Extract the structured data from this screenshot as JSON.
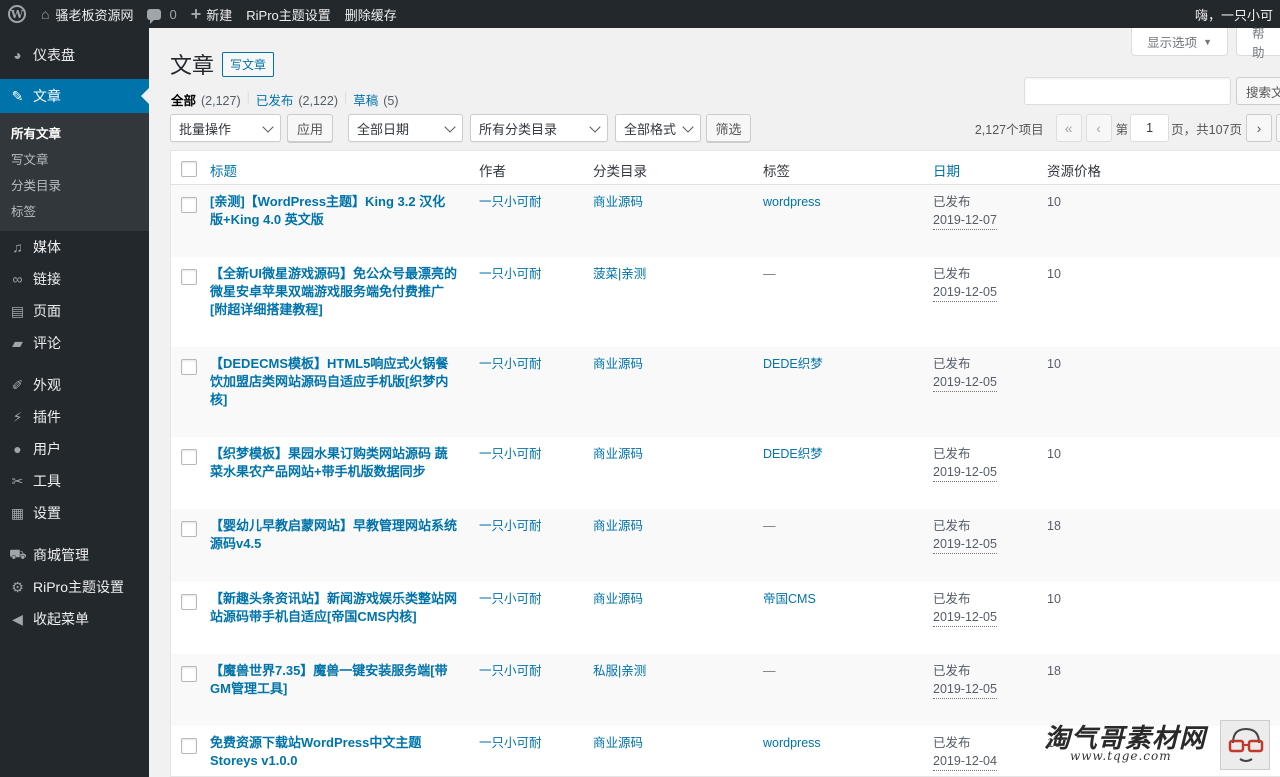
{
  "admin_bar": {
    "site_name": "骚老板资源网",
    "comments_count": "0",
    "new_label": "新建",
    "theme_settings": "RiPro主题设置",
    "clear_cache": "删除缓存",
    "greeting": "嗨，一只小可"
  },
  "sidebar": {
    "items": [
      {
        "label": "仪表盘",
        "icon": "dashboard-icon"
      },
      {
        "label": "文章",
        "icon": "pin-icon"
      },
      {
        "label": "媒体",
        "icon": "media-icon"
      },
      {
        "label": "链接",
        "icon": "link-icon"
      },
      {
        "label": "页面",
        "icon": "page-icon"
      },
      {
        "label": "评论",
        "icon": "comment-icon"
      },
      {
        "label": "外观",
        "icon": "brush-icon"
      },
      {
        "label": "插件",
        "icon": "plugin-icon"
      },
      {
        "label": "用户",
        "icon": "user-icon"
      },
      {
        "label": "工具",
        "icon": "wrench-icon"
      },
      {
        "label": "设置",
        "icon": "settings-icon"
      },
      {
        "label": "商城管理",
        "icon": "cart-icon"
      },
      {
        "label": "RiPro主题设置",
        "icon": "gear-icon"
      },
      {
        "label": "收起菜单",
        "icon": "collapse-icon"
      }
    ],
    "submenu": [
      "所有文章",
      "写文章",
      "分类目录",
      "标签"
    ]
  },
  "screen_options": "显示选项",
  "help": "帮助",
  "page_title": "文章",
  "add_new": "写文章",
  "views": {
    "all_label": "全部",
    "all_count": "(2,127)",
    "published_label": "已发布",
    "published_count": "(2,122)",
    "drafts_label": "草稿",
    "drafts_count": "(5)"
  },
  "search_button": "搜索文章",
  "filters": {
    "bulk_actions": "批量操作",
    "apply": "应用",
    "dates": "全部日期",
    "categories": "所有分类目录",
    "formats": "全部格式",
    "filter": "筛选"
  },
  "pagination": {
    "items": "2,127个项目",
    "first": "«",
    "prev": "‹",
    "page_prefix": "第",
    "current_page": "1",
    "page_suffix": "页，共107页",
    "next": "›"
  },
  "columns": {
    "title": "标题",
    "author": "作者",
    "categories": "分类目录",
    "tags": "标签",
    "date": "日期",
    "price": "资源价格"
  },
  "posts": [
    {
      "title": "[亲测]【WordPress主题】King 3.2 汉化版+King 4.0 英文版",
      "author": "一只小可耐",
      "category": "商业源码",
      "tags": "wordpress",
      "status": "已发布",
      "date": "2019-12-07",
      "price": "10"
    },
    {
      "title": "【全新UI微星游戏源码】免公众号最漂亮的微星安卓苹果双端游戏服务端免付费推广[附超详细搭建教程]",
      "author": "一只小可耐",
      "category": "菠菜|亲测",
      "tags": "—",
      "status": "已发布",
      "date": "2019-12-05",
      "price": "10"
    },
    {
      "title": "【DEDECMS模板】HTML5响应式火锅餐饮加盟店类网站源码自适应手机版[织梦内核]",
      "author": "一只小可耐",
      "category": "商业源码",
      "tags": "DEDE织梦",
      "status": "已发布",
      "date": "2019-12-05",
      "price": "10"
    },
    {
      "title": "【织梦模板】果园水果订购类网站源码 蔬菜水果农产品网站+带手机版数据同步",
      "author": "一只小可耐",
      "category": "商业源码",
      "tags": "DEDE织梦",
      "status": "已发布",
      "date": "2019-12-05",
      "price": "10"
    },
    {
      "title": "【婴幼儿早教启蒙网站】早教管理网站系统源码v4.5",
      "author": "一只小可耐",
      "category": "商业源码",
      "tags": "—",
      "status": "已发布",
      "date": "2019-12-05",
      "price": "18"
    },
    {
      "title": "【新趣头条资讯站】新闻游戏娱乐类整站网站源码带手机自适应[帝国CMS内核]",
      "author": "一只小可耐",
      "category": "商业源码",
      "tags": "帝国CMS",
      "status": "已发布",
      "date": "2019-12-05",
      "price": "10"
    },
    {
      "title": "【魔兽世界7.35】魔兽一键安装服务端[带GM管理工具]",
      "author": "一只小可耐",
      "category": "私服|亲测",
      "tags": "—",
      "status": "已发布",
      "date": "2019-12-05",
      "price": "18"
    },
    {
      "title": "免费资源下载站WordPress中文主题Storeys v1.0.0",
      "author": "一只小可耐",
      "category": "商业源码",
      "tags": "wordpress",
      "status": "已发布",
      "date": "2019-12-04",
      "price": "10"
    }
  ],
  "watermark": {
    "text": "淘气哥素材网",
    "url": "www.tqge.com"
  },
  "colors": {
    "admin_dark": "#23282d",
    "accent": "#0073aa",
    "background": "#f1f1f1"
  }
}
